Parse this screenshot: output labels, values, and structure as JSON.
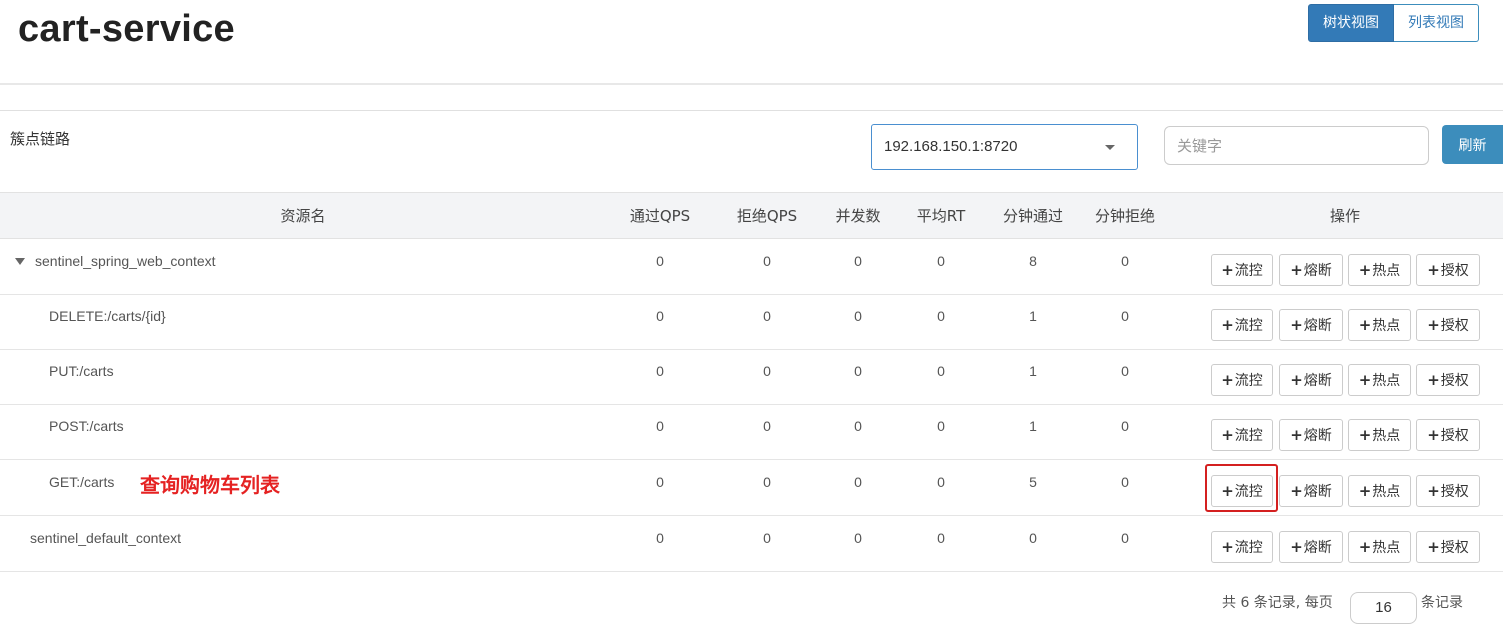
{
  "header": {
    "title": "cart-service",
    "view_tree": "树状视图",
    "view_list": "列表视图"
  },
  "toolbar": {
    "section_title": "簇点链路",
    "machine_selected": "192.168.150.1:8720",
    "keyword_placeholder": "关键字",
    "refresh_label": "刷新"
  },
  "table": {
    "columns": [
      "资源名",
      "通过QPS",
      "拒绝QPS",
      "并发数",
      "平均RT",
      "分钟通过",
      "分钟拒绝",
      "操作"
    ],
    "rows": [
      {
        "name": "sentinel_spring_web_context",
        "pass_qps": "0",
        "block_qps": "0",
        "concurrency": "0",
        "avg_rt": "0",
        "minute_pass": "8",
        "minute_block": "0"
      },
      {
        "name": "DELETE:/carts/{id}",
        "pass_qps": "0",
        "block_qps": "0",
        "concurrency": "0",
        "avg_rt": "0",
        "minute_pass": "1",
        "minute_block": "0"
      },
      {
        "name": "PUT:/carts",
        "pass_qps": "0",
        "block_qps": "0",
        "concurrency": "0",
        "avg_rt": "0",
        "minute_pass": "1",
        "minute_block": "0"
      },
      {
        "name": "POST:/carts",
        "pass_qps": "0",
        "block_qps": "0",
        "concurrency": "0",
        "avg_rt": "0",
        "minute_pass": "1",
        "minute_block": "0"
      },
      {
        "name": "GET:/carts",
        "pass_qps": "0",
        "block_qps": "0",
        "concurrency": "0",
        "avg_rt": "0",
        "minute_pass": "5",
        "minute_block": "0",
        "annotation": "查询购物车列表"
      },
      {
        "name": "sentinel_default_context",
        "pass_qps": "0",
        "block_qps": "0",
        "concurrency": "0",
        "avg_rt": "0",
        "minute_pass": "0",
        "minute_block": "0"
      }
    ],
    "actions": {
      "plus": "+",
      "flow": "流控",
      "degrade": "熔断",
      "hot": "热点",
      "auth": "授权"
    }
  },
  "pager": {
    "prefix": "共 6 条记录, 每页",
    "page_size": "16",
    "suffix": "条记录"
  },
  "colors": {
    "primary": "#337ab7",
    "annotation": "#e52222",
    "highlight_border": "#d42020"
  }
}
